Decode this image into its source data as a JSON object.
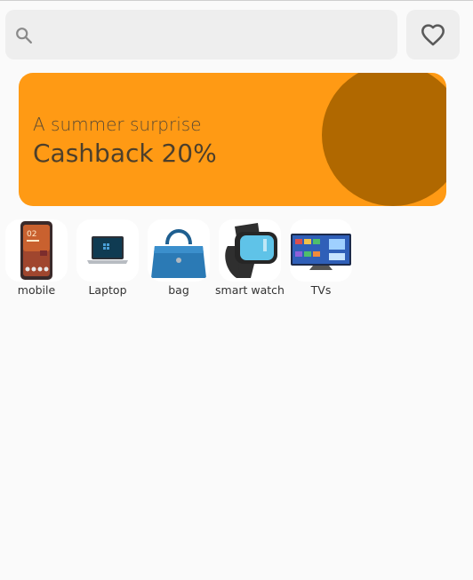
{
  "search": {
    "placeholder": ""
  },
  "banner": {
    "subtitle": "A summer surprise",
    "title": "Cashback 20%",
    "colors": {
      "background": "#ff9a14",
      "circle": "#b06800"
    }
  },
  "categories": [
    {
      "label": "mobile",
      "icon": "mobile-phone-icon"
    },
    {
      "label": "Laptop",
      "icon": "laptop-icon"
    },
    {
      "label": "bag",
      "icon": "handbag-icon"
    },
    {
      "label": "smart watch",
      "icon": "smart-watch-icon"
    },
    {
      "label": "TVs",
      "icon": "tv-icon"
    }
  ],
  "icons": {
    "search": "search-icon",
    "favorite": "heart-outline-icon"
  }
}
